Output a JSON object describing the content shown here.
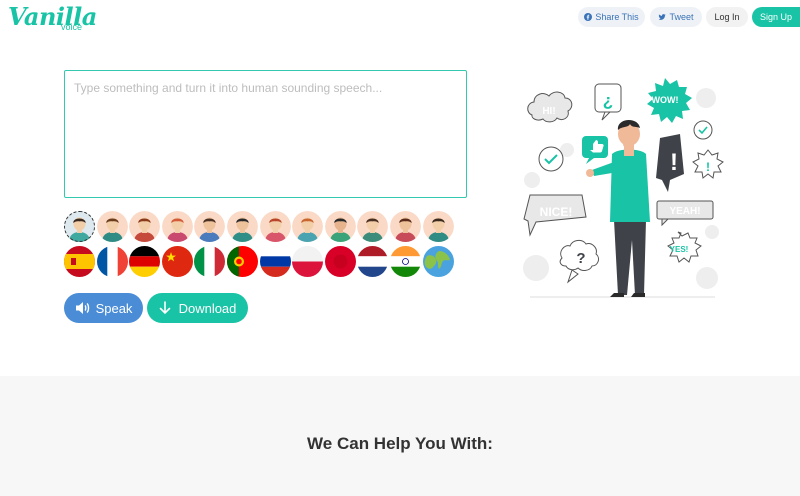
{
  "brand": {
    "name": "Vanilla",
    "sub": "voice"
  },
  "nav": {
    "share": "Share This",
    "tweet": "Tweet",
    "login": "Log In",
    "signup": "Sign Up"
  },
  "editor": {
    "placeholder": "Type something and turn it into human sounding speech..."
  },
  "voices": [
    {
      "skin": "#f3cfa9",
      "hair": "#3b2a20",
      "shirt": "#3fa9a0",
      "bg": "#dde9ee"
    },
    {
      "skin": "#f3cfa9",
      "hair": "#6b3c1e",
      "shirt": "#2e8c84",
      "bg": "#fbd9c7"
    },
    {
      "skin": "#f3cfa9",
      "hair": "#8b3a1a",
      "shirt": "#c64a3b",
      "bg": "#fbd9c7"
    },
    {
      "skin": "#f3cfa9",
      "hair": "#d45b3a",
      "shirt": "#c94a6e",
      "bg": "#fbd9c7"
    },
    {
      "skin": "#eec29b",
      "hair": "#4a3022",
      "shirt": "#4a7bbd",
      "bg": "#fbd9c7"
    },
    {
      "skin": "#eec29b",
      "hair": "#2a2a2a",
      "shirt": "#2f8f86",
      "bg": "#fbd9c7"
    },
    {
      "skin": "#f3cfa9",
      "hair": "#b8442a",
      "shirt": "#d9566a",
      "bg": "#fbd9c7"
    },
    {
      "skin": "#f3cfa9",
      "hair": "#c9662f",
      "shirt": "#4aa3b0",
      "bg": "#fbd9c7"
    },
    {
      "skin": "#e6b38d",
      "hair": "#2a2a2a",
      "shirt": "#3aa37a",
      "bg": "#fbd9c7"
    },
    {
      "skin": "#f3cfa9",
      "hair": "#4a3022",
      "shirt": "#3b8c7a",
      "bg": "#fbd9c7"
    },
    {
      "skin": "#eec29b",
      "hair": "#5a2a1a",
      "shirt": "#c84b5a",
      "bg": "#fbd9c7"
    },
    {
      "skin": "#f3cfa9",
      "hair": "#3b2a20",
      "shirt": "#2e8c84",
      "bg": "#fbd9c7"
    }
  ],
  "flags": [
    "spain",
    "france",
    "germany",
    "china",
    "italy",
    "portugal",
    "russia",
    "poland",
    "japan",
    "netherlands",
    "india",
    "world"
  ],
  "actions": {
    "speak": "Speak",
    "download": "Download"
  },
  "section": {
    "help_title": "We Can Help You With:"
  },
  "bubbles": {
    "hi": "HI!",
    "wow": "WOW!",
    "nice": "NICE!",
    "yeah": "YEAH!",
    "yes": "YES!"
  },
  "colors": {
    "accent": "#19c3a6",
    "blue": "#4a8cd6"
  }
}
